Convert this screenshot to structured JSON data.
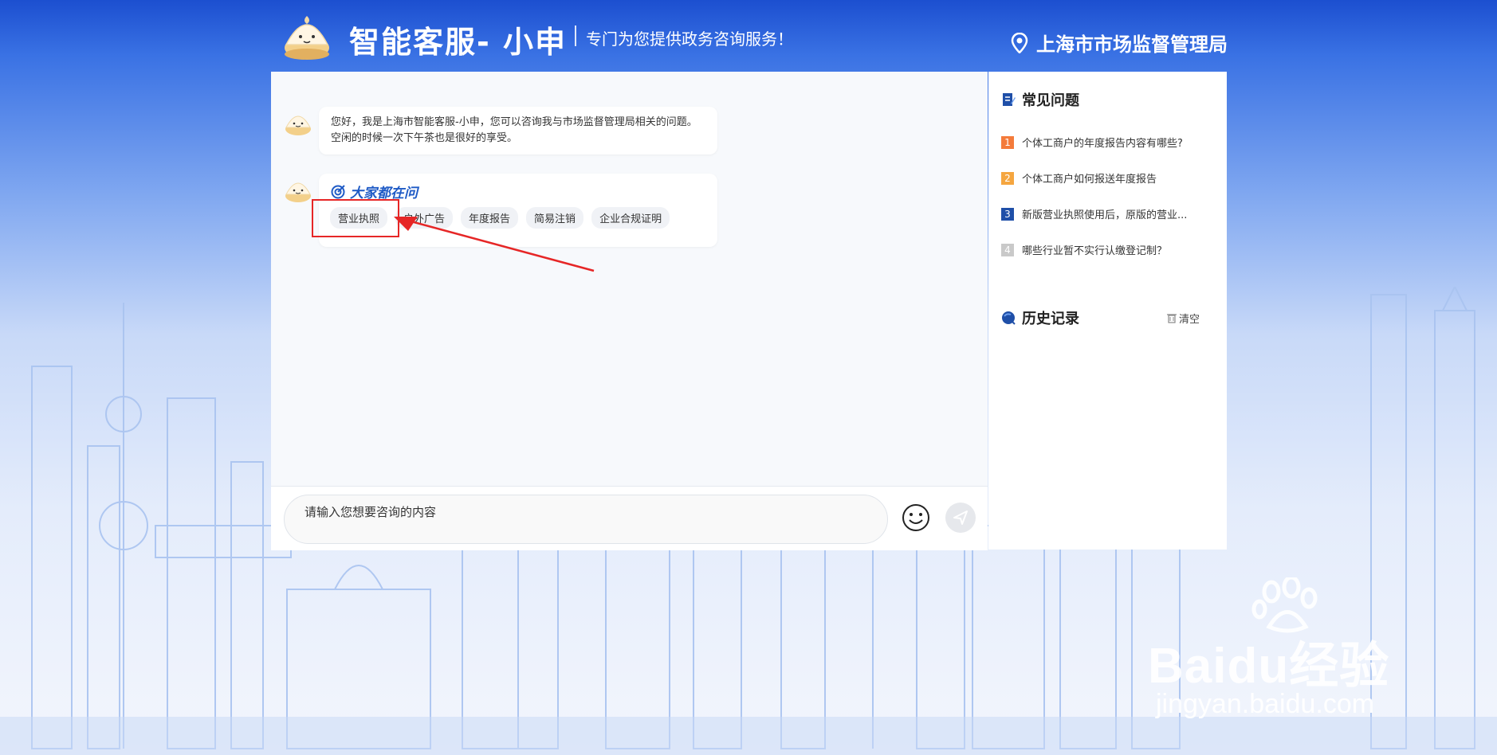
{
  "header": {
    "title": "智能客服- 小申",
    "subtitle": "专门为您提供政务咨询服务！",
    "location": "上海市市场监督管理局"
  },
  "chat": {
    "greeting": "您好，我是上海市智能客服-小申，您可以咨询我与市场监督管理局相关的问题。空闲的时候一次下午茶也是很好的享受。",
    "hot_title": "大家都在问",
    "hot_tags": [
      "营业执照",
      "户外广告",
      "年度报告",
      "简易注销",
      "企业合规证明"
    ]
  },
  "input": {
    "placeholder": "请输入您想要咨询的内容"
  },
  "faq": {
    "title": "常见问题",
    "items": [
      {
        "num": "1",
        "text": "个体工商户的年度报告内容有哪些?",
        "color": "#f47b3b"
      },
      {
        "num": "2",
        "text": "个体工商户如何报送年度报告",
        "color": "#f5a640"
      },
      {
        "num": "3",
        "text": "新版营业执照使用后，原版的营业...",
        "color": "#1f4fa8"
      },
      {
        "num": "4",
        "text": "哪些行业暂不实行认缴登记制？",
        "color": "#c9c9c9"
      }
    ]
  },
  "history": {
    "title": "历史记录",
    "clear_label": "清空"
  },
  "watermark": {
    "logo": "Baidu经验",
    "url": "jingyan.baidu.com"
  },
  "colors": {
    "accent": "#1f5bc6",
    "highlight": "#e62626"
  }
}
